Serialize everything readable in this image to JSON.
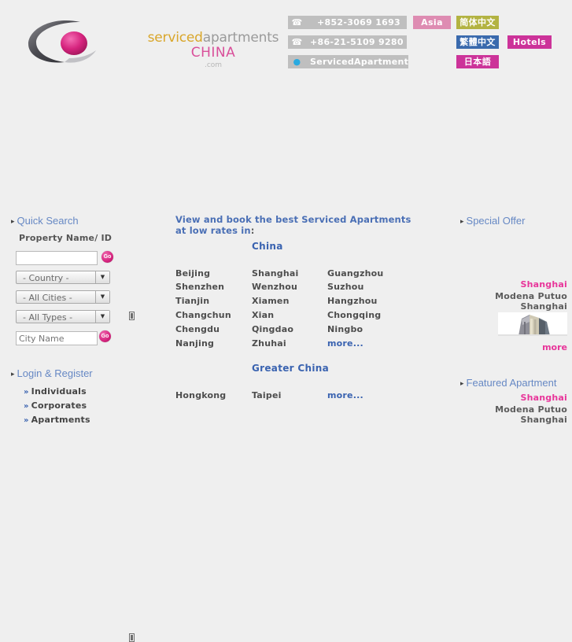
{
  "header": {
    "brand": {
      "serviced": "serviced",
      "apartments": "apartments",
      "china": "CHINA",
      "com": ".com"
    },
    "contacts": [
      {
        "icon": "telephone-icon",
        "glyph": "☎",
        "text": "+852-3069 1693"
      },
      {
        "icon": "telephone-icon",
        "glyph": "☎",
        "text": "+86-21-5109 9280"
      },
      {
        "icon": "skype-icon",
        "glyph": "S",
        "text": "ServicedApartment"
      }
    ],
    "badges": {
      "asia": "Asia",
      "simplified_chinese": "简体中文",
      "traditional_chinese": "繁體中文",
      "japanese": "日本語",
      "hotels": "Hotels"
    },
    "colors": {
      "asia": "#de8cb2",
      "simplified_chinese": "#b3b342",
      "traditional_chinese": "#3a6aad",
      "japanese": "#cc3399",
      "hotels": "#cc3399",
      "pill": "#bfbfbf",
      "brand_gold": "#d9a62a",
      "brand_pink": "#d94f9a"
    }
  },
  "left": {
    "quick_search": {
      "heading": "Quick Search",
      "property_label": "Property Name/ ID",
      "property_value": "",
      "property_placeholder": "",
      "go_label": "Go",
      "country_select": "- Country -",
      "cities_select": "- All Cities -",
      "types_select": "- All Types -",
      "city_value": "",
      "city_placeholder": "City Name"
    },
    "login": {
      "heading": "Login & Register",
      "items": [
        {
          "label": "Individuals"
        },
        {
          "label": "Corporates"
        },
        {
          "label": "Apartments"
        }
      ]
    }
  },
  "center": {
    "headline_main": "View and book the best Serviced Apartments at low rates in",
    "headline_tail": ":",
    "regions": [
      {
        "title": "China",
        "cities": [
          [
            "Beijing",
            "Shanghai",
            "Guangzhou"
          ],
          [
            "Shenzhen",
            "Wenzhou",
            "Suzhou"
          ],
          [
            "Tianjin",
            "Xiamen",
            "Hangzhou"
          ],
          [
            "Changchun",
            "Xian",
            "Chongqing"
          ],
          [
            "Chengdu",
            "Qingdao",
            "Ningbo"
          ],
          [
            "Nanjing",
            "Zhuhai",
            "more..."
          ]
        ]
      },
      {
        "title": "Greater China",
        "cities": [
          [
            "Hongkong",
            "Taipei",
            "more..."
          ]
        ]
      }
    ]
  },
  "right": {
    "special_offer": {
      "heading": "Special Offer",
      "city": "Shanghai",
      "name": "Modena Putuo Shanghai",
      "more": "more"
    },
    "featured_apartment": {
      "heading": "Featured Apartment",
      "city": "Shanghai",
      "name": "Modena Putuo Shanghai"
    }
  }
}
